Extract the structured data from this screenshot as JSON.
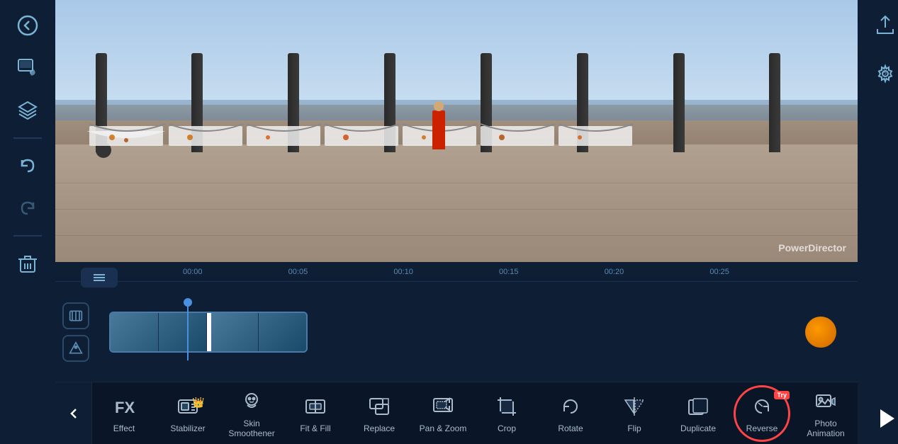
{
  "app": {
    "title": "PowerDirector"
  },
  "sidebar_left": {
    "buttons": [
      {
        "name": "back-button",
        "icon": "←",
        "label": "Back"
      },
      {
        "name": "media-music-button",
        "icon": "🎬",
        "label": "Media"
      },
      {
        "name": "layers-button",
        "icon": "◆",
        "label": "Layers"
      },
      {
        "name": "undo-button",
        "icon": "↩",
        "label": "Undo"
      },
      {
        "name": "redo-button",
        "icon": "↪",
        "label": "Redo"
      },
      {
        "name": "delete-button",
        "icon": "🗑",
        "label": "Delete"
      }
    ]
  },
  "video_preview": {
    "watermark": "PowerDirector"
  },
  "timeline": {
    "ruler_marks": [
      "00:00",
      "00:05",
      "00:10",
      "00:15",
      "00:20",
      "00:25"
    ]
  },
  "sidebar_right": {
    "export_label": "Export",
    "settings_label": "Settings",
    "play_label": "Play"
  },
  "toolbar": {
    "back_arrow": "‹",
    "items": [
      {
        "id": "fx",
        "label": "Effect",
        "has_crown": false,
        "highlighted": false
      },
      {
        "id": "stabilizer",
        "label": "Stabilizer",
        "has_crown": true,
        "highlighted": false
      },
      {
        "id": "skin-smoothener",
        "label": "Skin\nSmoothener",
        "has_crown": false,
        "highlighted": false
      },
      {
        "id": "fit-fill",
        "label": "Fit & Fill",
        "has_crown": false,
        "highlighted": false
      },
      {
        "id": "replace",
        "label": "Replace",
        "has_crown": false,
        "highlighted": false
      },
      {
        "id": "pan-zoom",
        "label": "Pan & Zoom",
        "has_crown": false,
        "highlighted": false
      },
      {
        "id": "crop",
        "label": "Crop",
        "has_crown": false,
        "highlighted": false
      },
      {
        "id": "rotate",
        "label": "Rotate",
        "has_crown": false,
        "highlighted": false
      },
      {
        "id": "flip",
        "label": "Flip",
        "has_crown": false,
        "highlighted": false
      },
      {
        "id": "duplicate",
        "label": "Duplicate",
        "has_crown": false,
        "highlighted": false
      },
      {
        "id": "reverse",
        "label": "Reverse",
        "has_crown": false,
        "highlighted": true,
        "has_try": true
      },
      {
        "id": "photo-animation",
        "label": "Photo\nAnimation",
        "has_crown": false,
        "highlighted": false
      }
    ]
  }
}
